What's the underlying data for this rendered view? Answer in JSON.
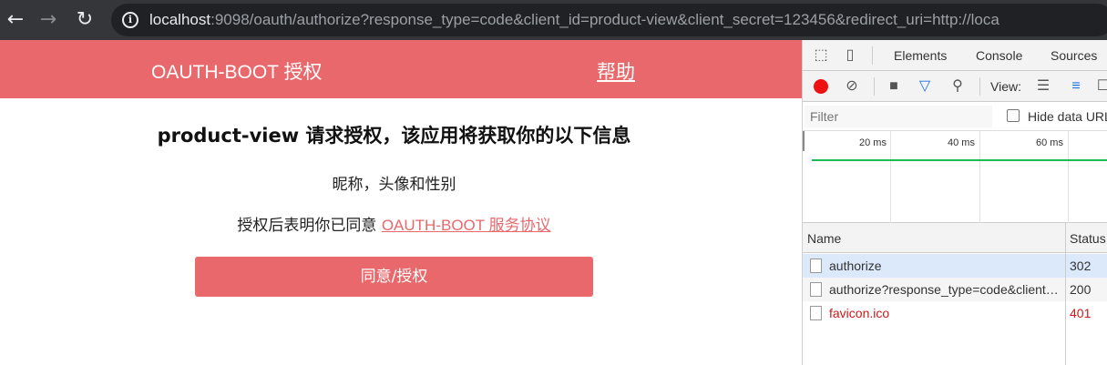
{
  "browser": {
    "back_icon": "←",
    "forward_icon": "→",
    "reload_icon": "↻",
    "info_icon": "i",
    "url_host": "localhost",
    "url_rest": ":9098/oauth/authorize?response_type=code&client_id=product-view&client_secret=123456&redirect_uri=http://loca"
  },
  "app": {
    "title": "OAUTH-BOOT 授权",
    "help_link": "帮助",
    "accent_color": "#e9686b"
  },
  "auth": {
    "request_title": "product-view 请求授权，该应用将获取你的以下信息",
    "scope": "昵称，头像和性别",
    "agree_prefix": "授权后表明你已同意 ",
    "agree_link": "OAUTH-BOOT 服务协议",
    "button_label": "同意/授权"
  },
  "devtools": {
    "tabs": [
      "Elements",
      "Console",
      "Sources"
    ],
    "view_label": "View:",
    "filter_placeholder": "Filter",
    "hide_data_label": "Hide data URLs",
    "timeline_ticks": [
      "20 ms",
      "40 ms",
      "60 ms"
    ],
    "columns": {
      "name": "Name",
      "status": "Status"
    },
    "requests": [
      {
        "name": "authorize",
        "status": "302"
      },
      {
        "name": "authorize?response_type=code&client_id=product-view",
        "status": "200"
      },
      {
        "name": "favicon.ico",
        "status": "401"
      }
    ]
  }
}
